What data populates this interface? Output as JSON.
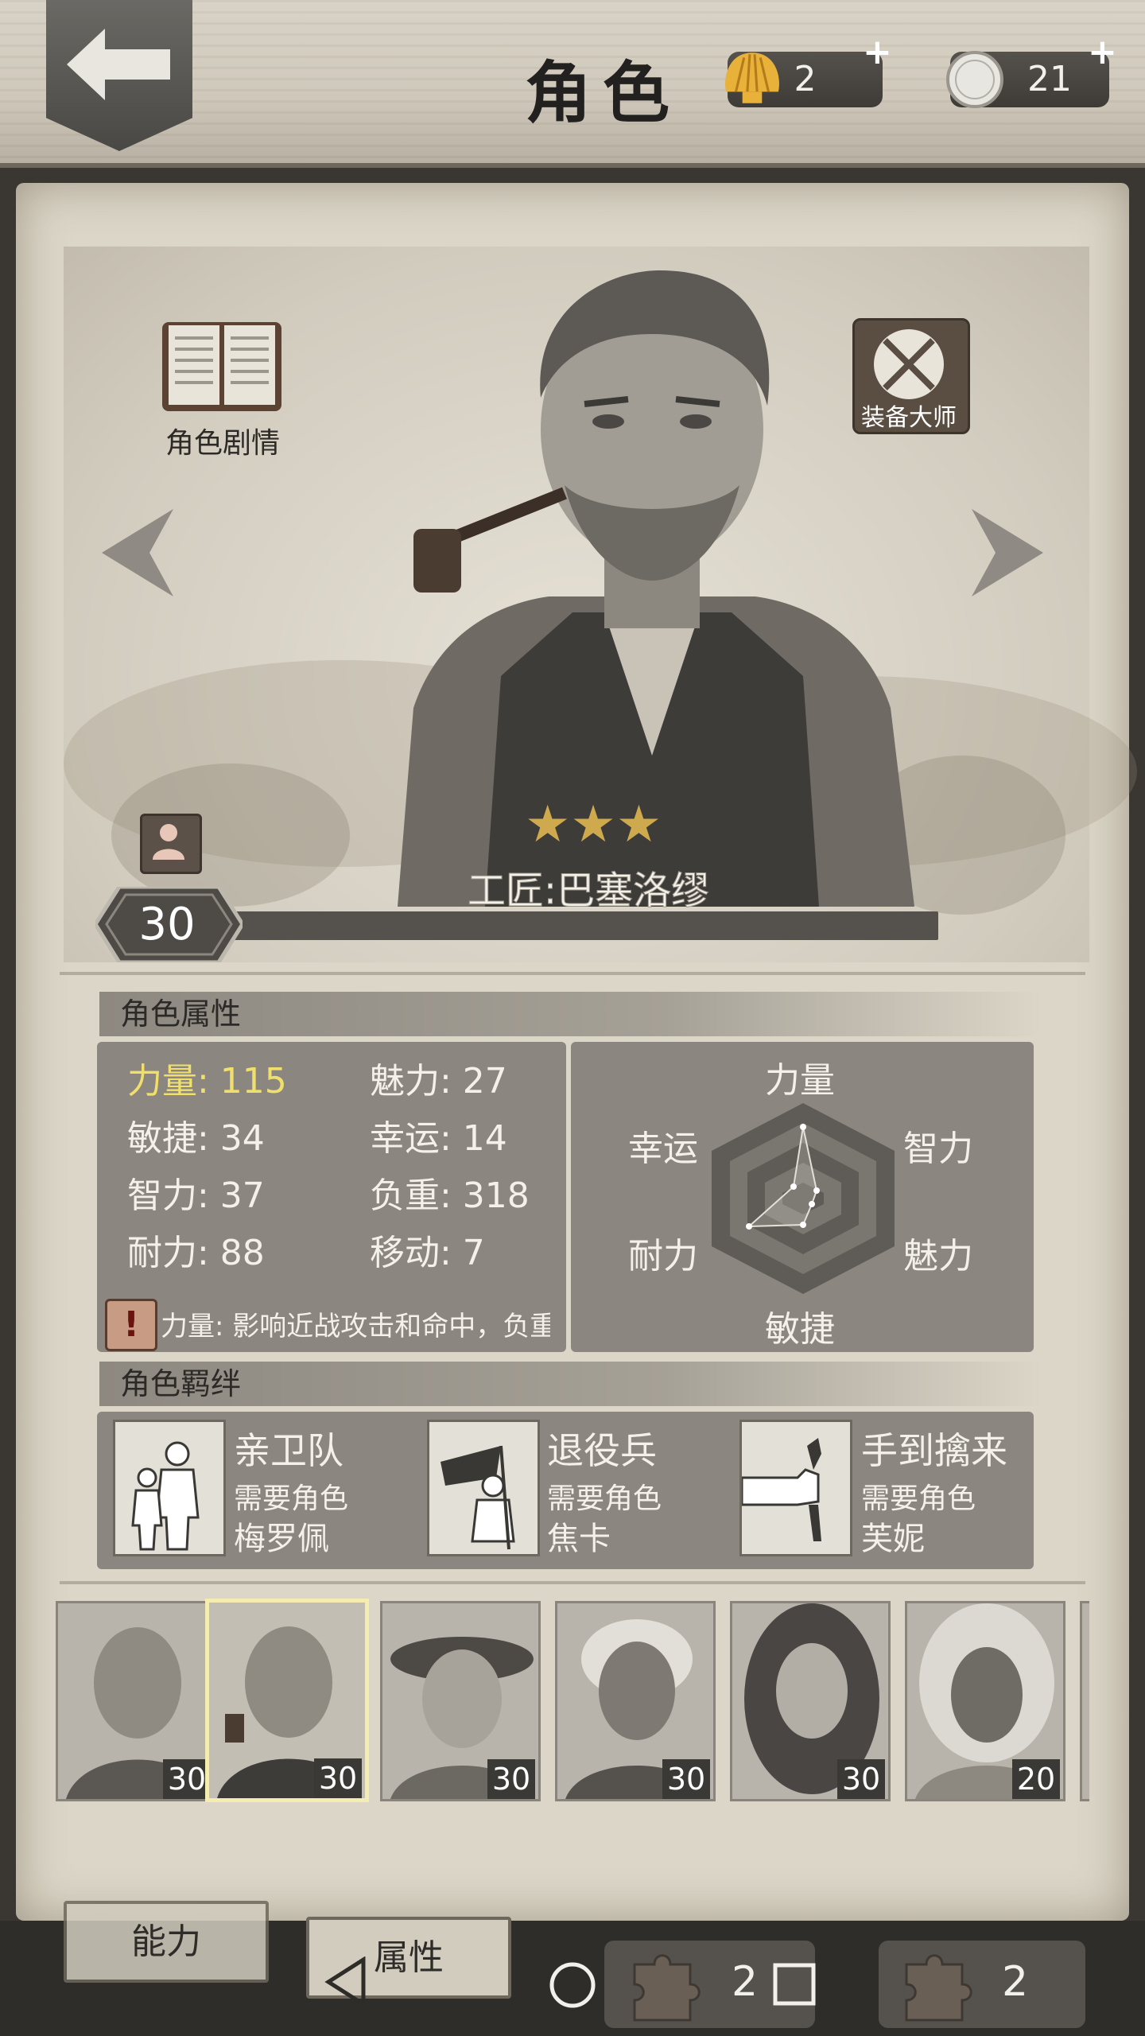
{
  "header": {
    "title": "角色",
    "currency": [
      {
        "icon": "shell-icon",
        "value": "2",
        "plus": "+"
      },
      {
        "icon": "coin-icon",
        "value": "21",
        "plus": "+"
      }
    ]
  },
  "portrait": {
    "story_label": "角色剧情",
    "equip_label": "装备大师",
    "stars": [
      "★",
      "★",
      "★"
    ],
    "name": "工匠:巴塞洛缪",
    "level": "30"
  },
  "attributes": {
    "header": "角色属性",
    "stats": [
      {
        "text": "力量: 115",
        "highlight": true
      },
      {
        "text": "魅力: 27",
        "highlight": false
      },
      {
        "text": "敏捷: 34",
        "highlight": false
      },
      {
        "text": "幸运: 14",
        "highlight": false
      },
      {
        "text": "智力: 37",
        "highlight": false
      },
      {
        "text": "负重: 318",
        "highlight": false
      },
      {
        "text": "耐力: 88",
        "highlight": false
      },
      {
        "text": "移动: 7",
        "highlight": false
      }
    ],
    "tip": "力量: 影响近战攻击和命中，负重",
    "radar": {
      "labels": [
        "力量",
        "智力",
        "魅力",
        "敏捷",
        "耐力",
        "幸运"
      ]
    }
  },
  "bonds": {
    "header": "角色羁绊",
    "items": [
      {
        "title": "亲卫队",
        "sub": "需要角色",
        "req": "梅罗佩"
      },
      {
        "title": "退役兵",
        "sub": "需要角色",
        "req": "焦卡"
      },
      {
        "title": "手到擒来",
        "sub": "需要角色",
        "req": "芙妮"
      }
    ]
  },
  "roster": [
    {
      "level": "30",
      "selected": false
    },
    {
      "level": "30",
      "selected": true
    },
    {
      "level": "30",
      "selected": false
    },
    {
      "level": "30",
      "selected": false
    },
    {
      "level": "30",
      "selected": false
    },
    {
      "level": "20",
      "selected": false
    }
  ],
  "bottom": {
    "tabs": [
      "能力",
      "属性"
    ],
    "puzzles": [
      {
        "value": "2"
      },
      {
        "value": "2"
      }
    ]
  }
}
